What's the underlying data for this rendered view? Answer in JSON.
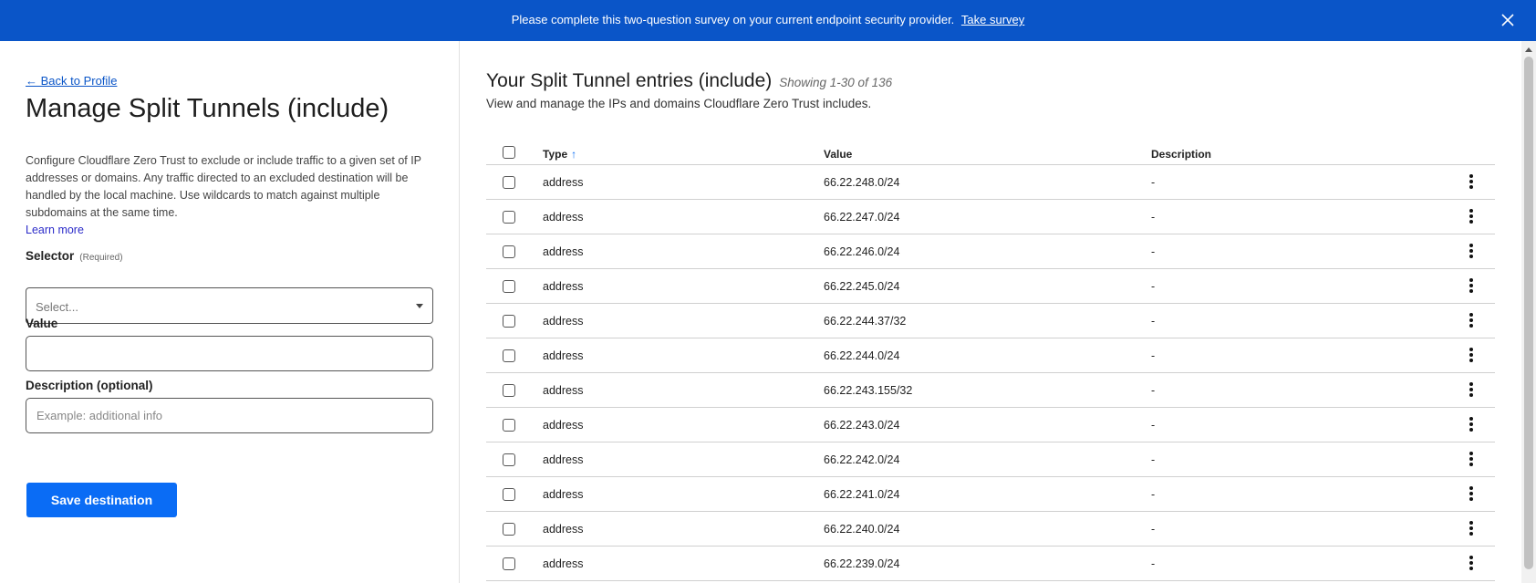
{
  "banner": {
    "message": "Please complete this two-question survey on your current endpoint security provider.",
    "link": "Take survey",
    "close_icon": "close-icon",
    "background": "#0a55c8"
  },
  "left": {
    "back_link": "← Back to Profile",
    "title": "Manage Split Tunnels (include)",
    "description": "Configure Cloudflare Zero Trust to exclude or include traffic to a given set of IP addresses or domains. Any traffic directed to an excluded destination will be handled by the local machine. Use wildcards to match against multiple subdomains at the same time.",
    "learn_more": "Learn more",
    "selector": {
      "label": "Selector",
      "required": "(Required)",
      "placeholder": "Select..."
    },
    "value": {
      "label": "Value",
      "value": ""
    },
    "description_field": {
      "label": "Description (optional)",
      "placeholder": "Example: additional info",
      "value": ""
    },
    "save_button": "Save destination"
  },
  "right": {
    "title": "Your Split Tunnel entries (include)",
    "showing": "Showing 1-30 of 136",
    "subtitle": "View and manage the IPs and domains Cloudflare Zero Trust includes.",
    "columns": {
      "type": "Type",
      "value": "Value",
      "description": "Description"
    },
    "sort_indicator": "↑",
    "rows": [
      {
        "type": "address",
        "value": "66.22.248.0/24",
        "description": "-"
      },
      {
        "type": "address",
        "value": "66.22.247.0/24",
        "description": "-"
      },
      {
        "type": "address",
        "value": "66.22.246.0/24",
        "description": "-"
      },
      {
        "type": "address",
        "value": "66.22.245.0/24",
        "description": "-"
      },
      {
        "type": "address",
        "value": "66.22.244.37/32",
        "description": "-"
      },
      {
        "type": "address",
        "value": "66.22.244.0/24",
        "description": "-"
      },
      {
        "type": "address",
        "value": "66.22.243.155/32",
        "description": "-"
      },
      {
        "type": "address",
        "value": "66.22.243.0/24",
        "description": "-"
      },
      {
        "type": "address",
        "value": "66.22.242.0/24",
        "description": "-"
      },
      {
        "type": "address",
        "value": "66.22.241.0/24",
        "description": "-"
      },
      {
        "type": "address",
        "value": "66.22.240.0/24",
        "description": "-"
      },
      {
        "type": "address",
        "value": "66.22.239.0/24",
        "description": "-"
      }
    ]
  }
}
